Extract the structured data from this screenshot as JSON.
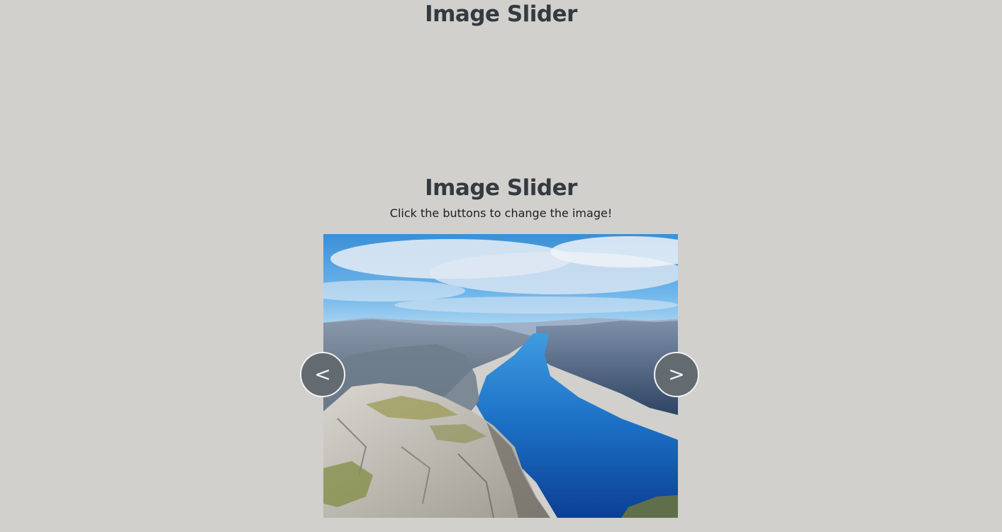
{
  "page": {
    "top_title": "Image Slider"
  },
  "slider": {
    "title": "Image Slider",
    "subtitle": "Click the buttons to change the image!",
    "prev_label": "<",
    "next_label": ">",
    "image_subject": "fjord-landscape-photo"
  },
  "colors": {
    "background": "#d1d0cc",
    "heading": "#343a40",
    "button": "#646b70",
    "button_border": "#f2f2f2"
  }
}
